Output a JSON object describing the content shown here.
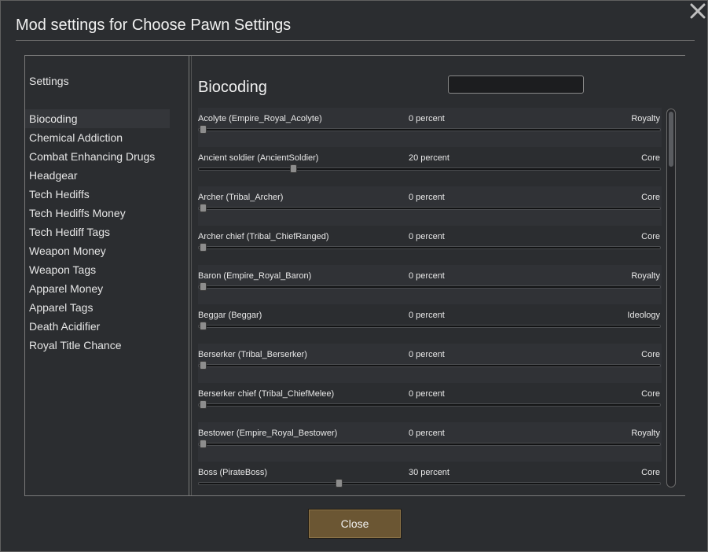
{
  "window": {
    "title": "Mod settings for Choose Pawn Settings",
    "close_icon": "close-icon"
  },
  "sidebar": {
    "heading": "Settings",
    "selected_index": 0,
    "items": [
      {
        "label": "Biocoding"
      },
      {
        "label": "Chemical Addiction"
      },
      {
        "label": "Combat Enhancing Drugs"
      },
      {
        "label": "Headgear"
      },
      {
        "label": "Tech Hediffs"
      },
      {
        "label": "Tech Hediffs Money"
      },
      {
        "label": "Tech Hediff Tags"
      },
      {
        "label": "Weapon Money"
      },
      {
        "label": "Weapon Tags"
      },
      {
        "label": "Apparel Money"
      },
      {
        "label": "Apparel Tags"
      },
      {
        "label": "Death Acidifier"
      },
      {
        "label": "Royal Title Chance"
      }
    ]
  },
  "content": {
    "title": "Biocoding",
    "search": {
      "value": "",
      "placeholder": ""
    },
    "rows": [
      {
        "label": "Acolyte (Empire_Royal_Acolyte)",
        "value_text": "0 percent",
        "value": 0,
        "source": "Royalty"
      },
      {
        "label": "Ancient soldier (AncientSoldier)",
        "value_text": "20 percent",
        "value": 20,
        "source": "Core"
      },
      {
        "label": "Archer (Tribal_Archer)",
        "value_text": "0 percent",
        "value": 0,
        "source": "Core"
      },
      {
        "label": "Archer chief (Tribal_ChiefRanged)",
        "value_text": "0 percent",
        "value": 0,
        "source": "Core"
      },
      {
        "label": "Baron (Empire_Royal_Baron)",
        "value_text": "0 percent",
        "value": 0,
        "source": "Royalty"
      },
      {
        "label": "Beggar (Beggar)",
        "value_text": "0 percent",
        "value": 0,
        "source": "Ideology"
      },
      {
        "label": "Berserker (Tribal_Berserker)",
        "value_text": "0 percent",
        "value": 0,
        "source": "Core"
      },
      {
        "label": "Berserker chief (Tribal_ChiefMelee)",
        "value_text": "0 percent",
        "value": 0,
        "source": "Core"
      },
      {
        "label": "Bestower (Empire_Royal_Bestower)",
        "value_text": "0 percent",
        "value": 0,
        "source": "Royalty"
      },
      {
        "label": "Boss (PirateBoss)",
        "value_text": "30 percent",
        "value": 30,
        "source": "Core"
      }
    ]
  },
  "footer": {
    "close_label": "Close"
  },
  "colors": {
    "button_fill": "#6b5633",
    "panel": "#2b2d30",
    "row_alt": "#303236"
  }
}
